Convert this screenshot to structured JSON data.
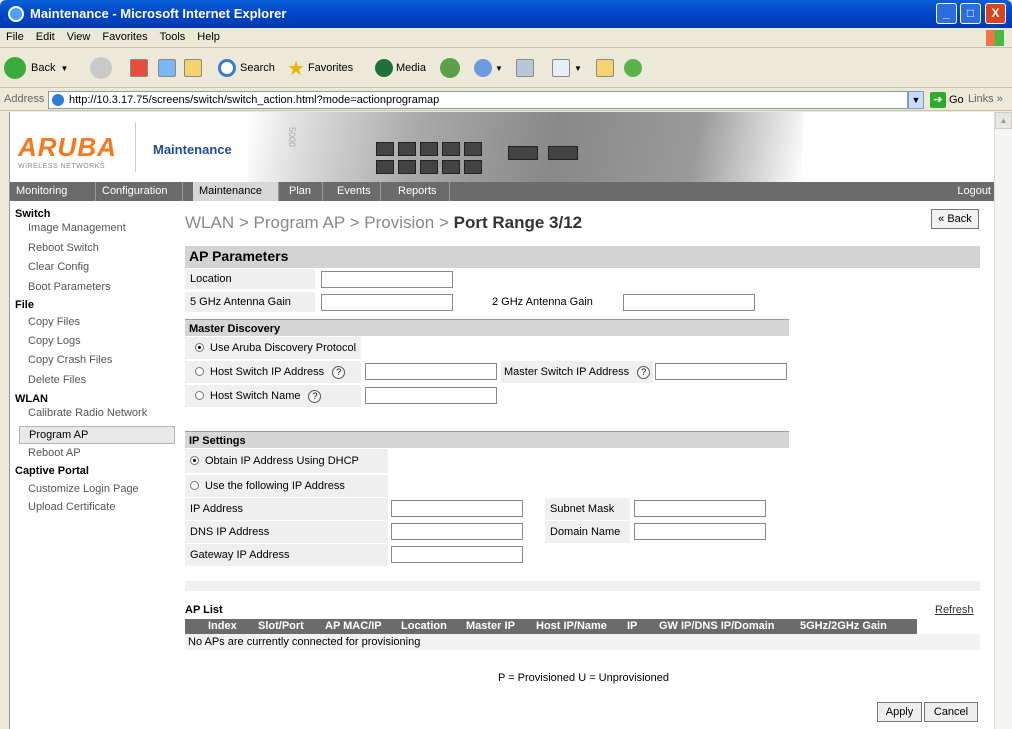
{
  "window": {
    "title": "Maintenance - Microsoft Internet Explorer",
    "minimize": "_",
    "maximize": "□",
    "close": "X"
  },
  "menu": [
    "File",
    "Edit",
    "View",
    "Favorites",
    "Tools",
    "Help"
  ],
  "toolbar": {
    "back": "Back",
    "search": "Search",
    "favorites": "Favorites",
    "media": "Media"
  },
  "address": {
    "label": "Address",
    "url": "http://10.3.17.75/screens/switch/switch_action.html?mode=actionprogramap",
    "go": "Go",
    "links": "Links"
  },
  "header": {
    "logo_word": "ARUBA",
    "logo_sub": "WIRELESS NETWORKS",
    "title": "Maintenance",
    "chassis_label": "5000"
  },
  "nav": {
    "items": [
      "Monitoring",
      "Configuration",
      "Maintenance",
      "Plan",
      "Events",
      "Reports"
    ],
    "active": "Maintenance",
    "logout": "Logout"
  },
  "sidebar": {
    "groups": [
      {
        "title": "Switch",
        "items": [
          "Image Management",
          "Reboot Switch",
          "Clear Config",
          "Boot Parameters"
        ]
      },
      {
        "title": "File",
        "items": [
          "Copy Files",
          "Copy Logs",
          "Copy Crash Files",
          "Delete Files"
        ]
      },
      {
        "title": "WLAN",
        "items": [
          "Calibrate Radio Network",
          "Program AP",
          "Reboot AP"
        ]
      },
      {
        "title": "Captive Portal",
        "items": [
          "Customize Login Page",
          "Upload Certificate"
        ]
      }
    ],
    "active_item": "Program AP"
  },
  "page": {
    "breadcrumb": [
      "WLAN",
      "Program AP",
      "Provision"
    ],
    "breadcrumb_sep": ">",
    "current": "Port Range 3/12",
    "back": "« Back"
  },
  "ap_params": {
    "title": "AP Parameters",
    "location": "Location",
    "gain_5": "5 GHz Antenna Gain",
    "gain_2": "2 GHz Antenna Gain"
  },
  "master_discovery": {
    "title": "Master Discovery",
    "opt_adp": "Use Aruba Discovery Protocol",
    "opt_host_ip": "Host Switch IP Address",
    "master_ip": "Master Switch IP Address",
    "opt_host_name": "Host Switch Name",
    "selected": "opt_adp",
    "help": "?"
  },
  "ip_settings": {
    "title": "IP Settings",
    "opt_dhcp": "Obtain IP Address Using DHCP",
    "opt_static": "Use the following IP Address",
    "selected": "opt_dhcp",
    "ip": "IP Address",
    "subnet": "Subnet Mask",
    "dns": "DNS IP Address",
    "domain": "Domain Name",
    "gateway": "Gateway IP Address"
  },
  "ap_list": {
    "title": "AP List",
    "refresh": "Refresh",
    "columns": [
      "Index",
      "Slot/Port",
      "AP MAC/IP",
      "Location",
      "Master IP",
      "Host IP/Name",
      "IP",
      "GW IP/DNS IP/Domain",
      "5GHz/2GHz Gain"
    ],
    "empty": "No APs are currently connected for provisioning",
    "legend": "P = Provisioned U = Unprovisioned"
  },
  "actions": {
    "apply": "Apply",
    "cancel": "Cancel"
  }
}
